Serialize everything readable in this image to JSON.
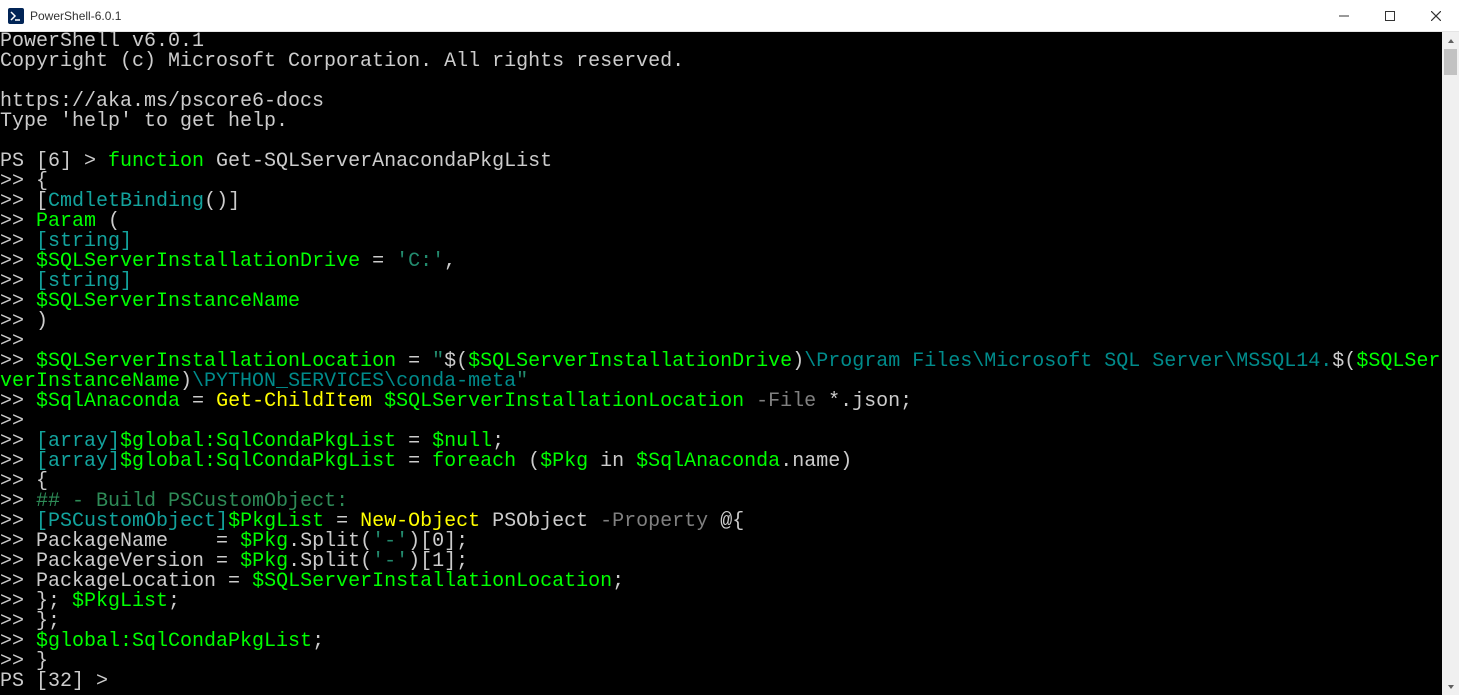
{
  "window": {
    "title": "PowerShell-6.0.1"
  },
  "terminal": {
    "header1": "PowerShell v6.0.1",
    "header2": "Copyright (c) Microsoft Corporation. All rights reserved.",
    "docs": "https://aka.ms/pscore6-docs",
    "help": "Type 'help' to get help.",
    "prompt1_pre": "PS [6] > ",
    "kw_function": "function",
    "fn_name": " Get-SQLServerAnacondaPkgList",
    "cont": ">>",
    "brace_open": " {",
    "cmdlet_binding_open": " [",
    "cmdlet_binding_attr": "CmdletBinding",
    "cmdlet_binding_close": "()]",
    "param_kw": " Param",
    "paren_open": " (",
    "string_type1": " [string]",
    "var_drive": " $SQLServerInstallationDrive",
    "eq": " = ",
    "drive_literal": "'C:'",
    "comma": ",",
    "string_type2": " [string]",
    "var_instance": " $SQLServerInstanceName",
    "paren_close": " )",
    "var_loc": " $SQLServerInstallationLocation",
    "str_open": "\"",
    "subexpr_open": "$(",
    "var_drive2": "$SQLServerInstallationDrive",
    "subexpr_close": ")",
    "path_seg1": "\\Program Files\\Microsoft SQL Server\\MSSQL14.",
    "var_instance2": "$SQLSer",
    "wrap_prefix": "verInstanceName",
    "path_seg2": "\\PYTHON_SERVICES\\conda-meta",
    "str_close": "\"",
    "var_anaconda": " $SqlAnaconda",
    "cmd_gci": "Get-ChildItem",
    "var_loc2": " $SQLServerInstallationLocation",
    "flag_file": " -File",
    "json_glob": " *.json;",
    "array_type": " [array]",
    "var_global": "$global:SqlCondaPkgList",
    "eq_null": " = ",
    "null_val": "$null",
    "semi": ";",
    "kw_foreach": "foreach",
    "foreach_args_open": " (",
    "var_pkg": "$Pkg",
    "kw_in": " in ",
    "var_anaconda2": "$SqlAnaconda",
    "dot_name": ".name)",
    "brace_open2": " {",
    "comment": " ## - Build PSCustomObject:",
    "pscustom_type": " [PSCustomObject]",
    "var_pkglist": "$PkgList",
    "cmd_newobj": "New-Object",
    "psobject": " PSObject",
    "flag_prop": " -Property",
    "at_brace": " @{",
    "pkg_name_label": " PackageName    = ",
    "var_pkg2": "$Pkg",
    "split_open": ".Split(",
    "dash_str": "'-'",
    "idx0": ")[",
    "zero": "0",
    "idx_close": "];",
    "pkg_ver_label": " PackageVersion = ",
    "one": "1",
    "pkg_loc_label": " PackageLocation = ",
    "var_loc3": "$SQLServerInstallationLocation",
    "brace_close_semi": " }; ",
    "var_pkglist2": "$PkgList",
    "brace_close": " };",
    "var_global2": " $global:SqlCondaPkgList",
    "brace_close_final": " }",
    "prompt2": "PS [32] >"
  }
}
